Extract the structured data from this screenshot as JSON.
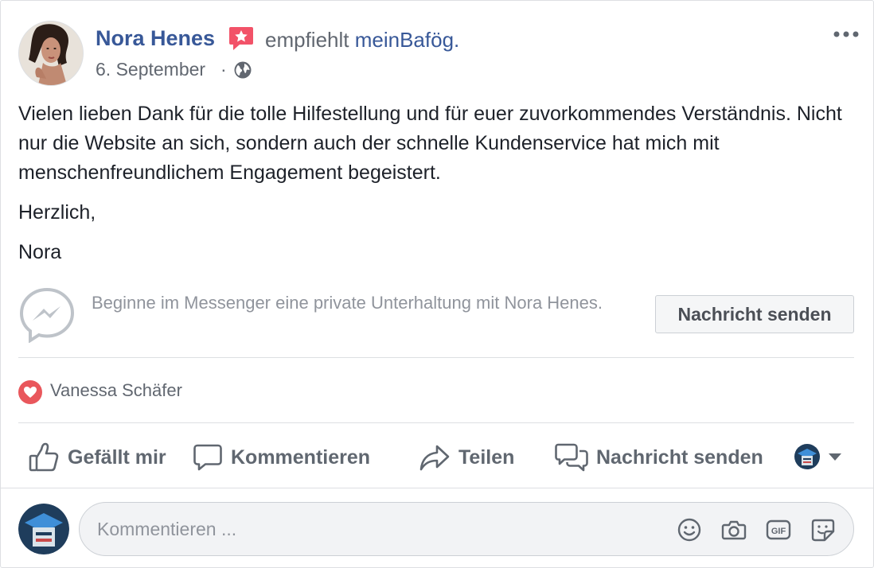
{
  "post": {
    "author_name": "Nora Henes",
    "recommends_text": "empfiehlt",
    "recommended_page": "meinBafög.",
    "date": "6. September",
    "date_separator": "·",
    "body_paragraphs": [
      "Vielen lieben Dank für die tolle Hilfestellung und für euer zuvorkommendes Verständnis. Nicht nur die Website an sich, sondern auch der schnelle Kundenservice hat mich mit menschenfreundlichem Engagement begeistert.",
      "Herzlich,",
      "Nora"
    ]
  },
  "messenger": {
    "prompt": "Beginne im Messenger eine private Unterhaltung mit Nora Henes.",
    "button_label": "Nachricht senden"
  },
  "reactions": {
    "reactor_name": "Vanessa Schäfer"
  },
  "actions": {
    "like_label": "Gefällt mir",
    "comment_label": "Kommentieren",
    "share_label": "Teilen",
    "message_label": "Nachricht senden"
  },
  "comment_input": {
    "placeholder": "Kommentieren ..."
  },
  "icons": {
    "recommend_badge": "recommend-star-icon",
    "privacy": "globe-icon",
    "more": "more-options-icon",
    "messenger": "messenger-icon",
    "heart": "heart-reaction-icon",
    "like": "thumbs-up-icon",
    "comment": "comment-bubble-icon",
    "share": "share-arrow-icon",
    "message": "message-bubbles-icon",
    "emoji": "emoji-icon",
    "camera": "camera-icon",
    "gif": "gif-icon",
    "sticker": "sticker-icon"
  },
  "colors": {
    "link_blue": "#385898",
    "secondary_text": "#616770",
    "heart_red": "#e9575c",
    "badge_red": "#f25268"
  }
}
